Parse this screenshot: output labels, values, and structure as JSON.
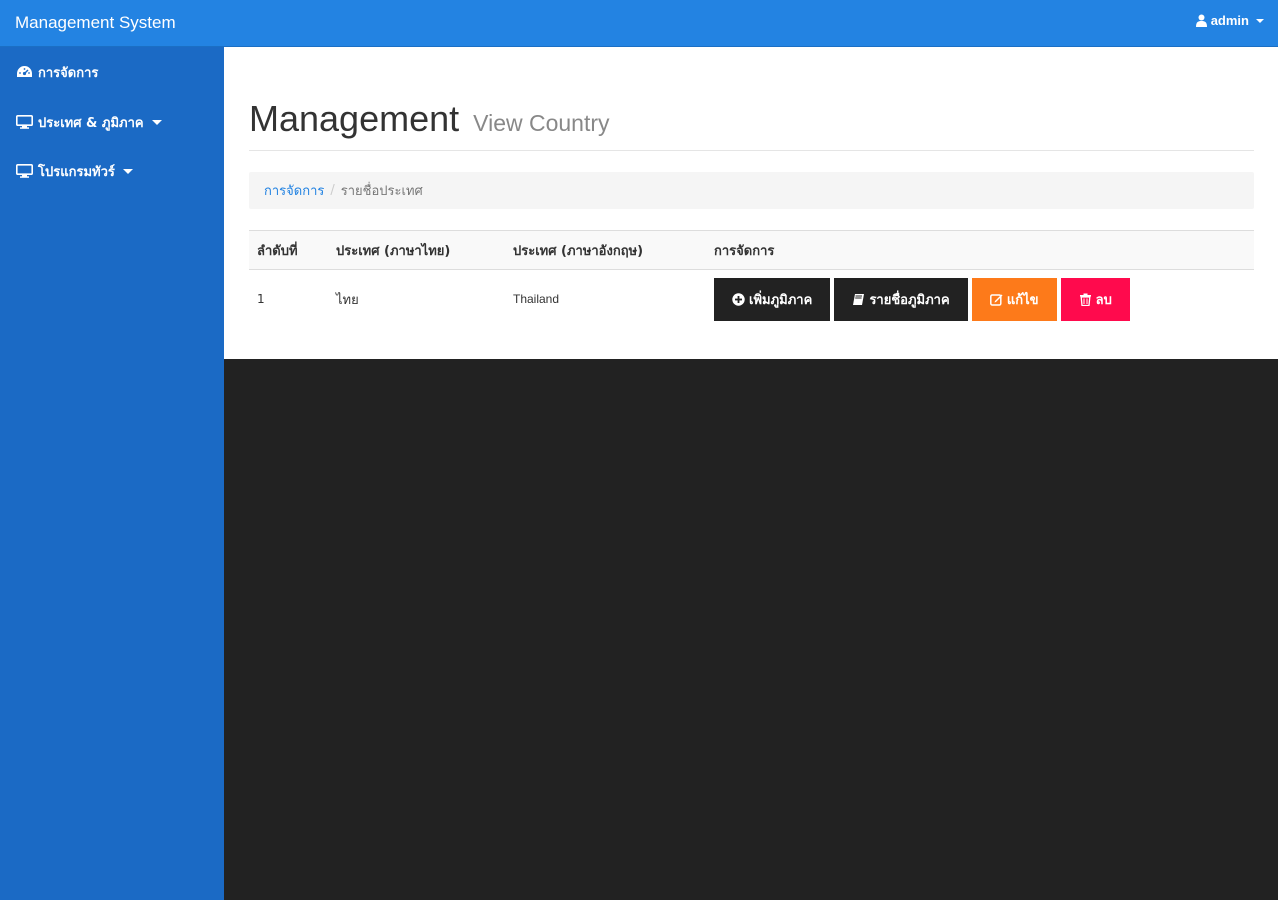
{
  "navbar": {
    "brand": "Management System",
    "user": "admin",
    "user_icon": "user-icon"
  },
  "sidebar": {
    "items": [
      {
        "label": "การจัดการ",
        "icon": "dashboard-icon"
      },
      {
        "label": "ประเทศ & ภูมิภาค",
        "icon": "desktop-icon",
        "has_dropdown": true
      },
      {
        "label": "โปรแกรมทัวร์",
        "icon": "desktop-icon",
        "has_dropdown": true
      }
    ]
  },
  "header": {
    "title": "Management",
    "subtitle": "View Country"
  },
  "breadcrumb": {
    "link": "การจัดการ",
    "active": "รายชื่อประเทศ"
  },
  "table": {
    "columns": [
      "ลำดับที่",
      "ประเทศ (ภาษาไทย)",
      "ประเทศ (ภาษาอังกฤษ)",
      "การจัดการ"
    ],
    "rows": [
      {
        "no": "1",
        "name_th": "ไทย",
        "name_en": "Thailand"
      }
    ],
    "actions": {
      "add_region": "เพิ่มภูมิภาค",
      "list_region": "รายชื่อภูมิภาค",
      "edit": "แก้ไข",
      "delete": "ลบ"
    }
  },
  "colors": {
    "navbar": "#2383e2",
    "sidebar": "#1b6ac5",
    "background": "#222222",
    "btn_dark": "#222222",
    "btn_orange": "#fd7a1a",
    "btn_red": "#ff0a4d"
  }
}
